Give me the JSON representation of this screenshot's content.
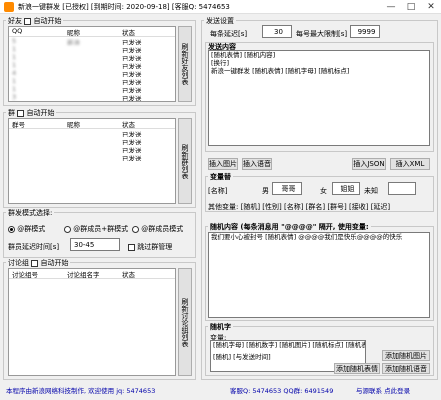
{
  "window": {
    "title": "新浪一键群发 [已授权] [到期时间: 2020-09-18] [客服Q: 5474653",
    "minimize": "—",
    "maximize": "□",
    "close": "✕"
  },
  "friends": {
    "legend": "好友",
    "auto_label": "自动开始",
    "columns": [
      "QQ",
      "昵称",
      "状态"
    ],
    "rows": [
      [
        "5",
        "新浪",
        "已发送"
      ],
      [
        "1",
        "",
        "已发送"
      ],
      [
        "1",
        "",
        "已发送"
      ],
      [
        "1",
        "",
        "已发送"
      ],
      [
        "4",
        "",
        "已发送"
      ],
      [
        "1",
        "",
        "已发送"
      ],
      [
        "1",
        "",
        "已发送"
      ],
      [
        "3",
        "",
        "已发送"
      ],
      [
        "1",
        "",
        "已发送"
      ]
    ],
    "side_button": "刷新好友列表"
  },
  "groups": {
    "legend": "群",
    "auto_label": "自动开始",
    "columns": [
      "群号",
      "昵称",
      "状态"
    ],
    "rows": [
      [
        "",
        "",
        "已发送"
      ],
      [
        "",
        "",
        "已发送"
      ],
      [
        "",
        "",
        "已发送"
      ],
      [
        "",
        "",
        "已发送"
      ]
    ],
    "side_button": "刷新群列表"
  },
  "group_mode": {
    "label": "群发模式选择:",
    "options": [
      "@群模式",
      "@群成员+群模式",
      "@群成员模式"
    ],
    "selected": 0,
    "delay_label": "群员延迟时间[s]",
    "delay_value": "30-45",
    "skip_label": "跳过群管理"
  },
  "discuss": {
    "legend": "讨论组",
    "auto_label": "自动开始",
    "columns": [
      "讨论组号",
      "讨论组名字",
      "状态"
    ],
    "side_button": "刷新讨论组列表"
  },
  "send_settings": {
    "legend": "发送设置",
    "delay_label": "每条延迟[s]",
    "delay_value": "30",
    "max_label": "每号最大限制[s]",
    "max_value": "9999"
  },
  "content": {
    "title": "发送内容",
    "lines": [
      "[随机表情]  [随机内容]",
      "[换行]",
      "新浪一键群发 [随机表情] [随机字母] [随机标点]"
    ],
    "insert_image": "插入图片",
    "insert_voice": "插入语音",
    "insert_json": "插入JSON",
    "insert_xml": "插入XML"
  },
  "variables": {
    "title": "变量替",
    "name_label": "[名称]",
    "name_prefix": "男",
    "name_value": "哥哥",
    "mid_label": "女",
    "mid_value": "姐姐",
    "unknown_label": "未知",
    "unknown_value": "",
    "other_text": "其他变量: [随机] [性别] [名称] [群名] [群号] [接收] [延迟]"
  },
  "random": {
    "title": "随机内容 (每条消息用 \"@@@@\" 隔开, 使用变量:",
    "text": "我们要小心被封号 [随机表情] @@@@我们是快乐@@@@的快乐",
    "chars_title": "随机字",
    "chars_sub": "变量:",
    "chars_line1": "[随机字母] [随机数字] [随机图片] [随机标点] [随机表情]",
    "chars_line2": "[随机] [与发送时间]",
    "add_image": "添加随机图片",
    "add_emoji": "添加随机表情",
    "add_voice": "添加随机语音"
  },
  "status": {
    "left": "本程序由新浪网络科技制作, 欢迎使用 jq: 5474653",
    "middle": "客服Q: 5474653  QQ群: 6491549",
    "right": "与源联系  点此登录"
  }
}
